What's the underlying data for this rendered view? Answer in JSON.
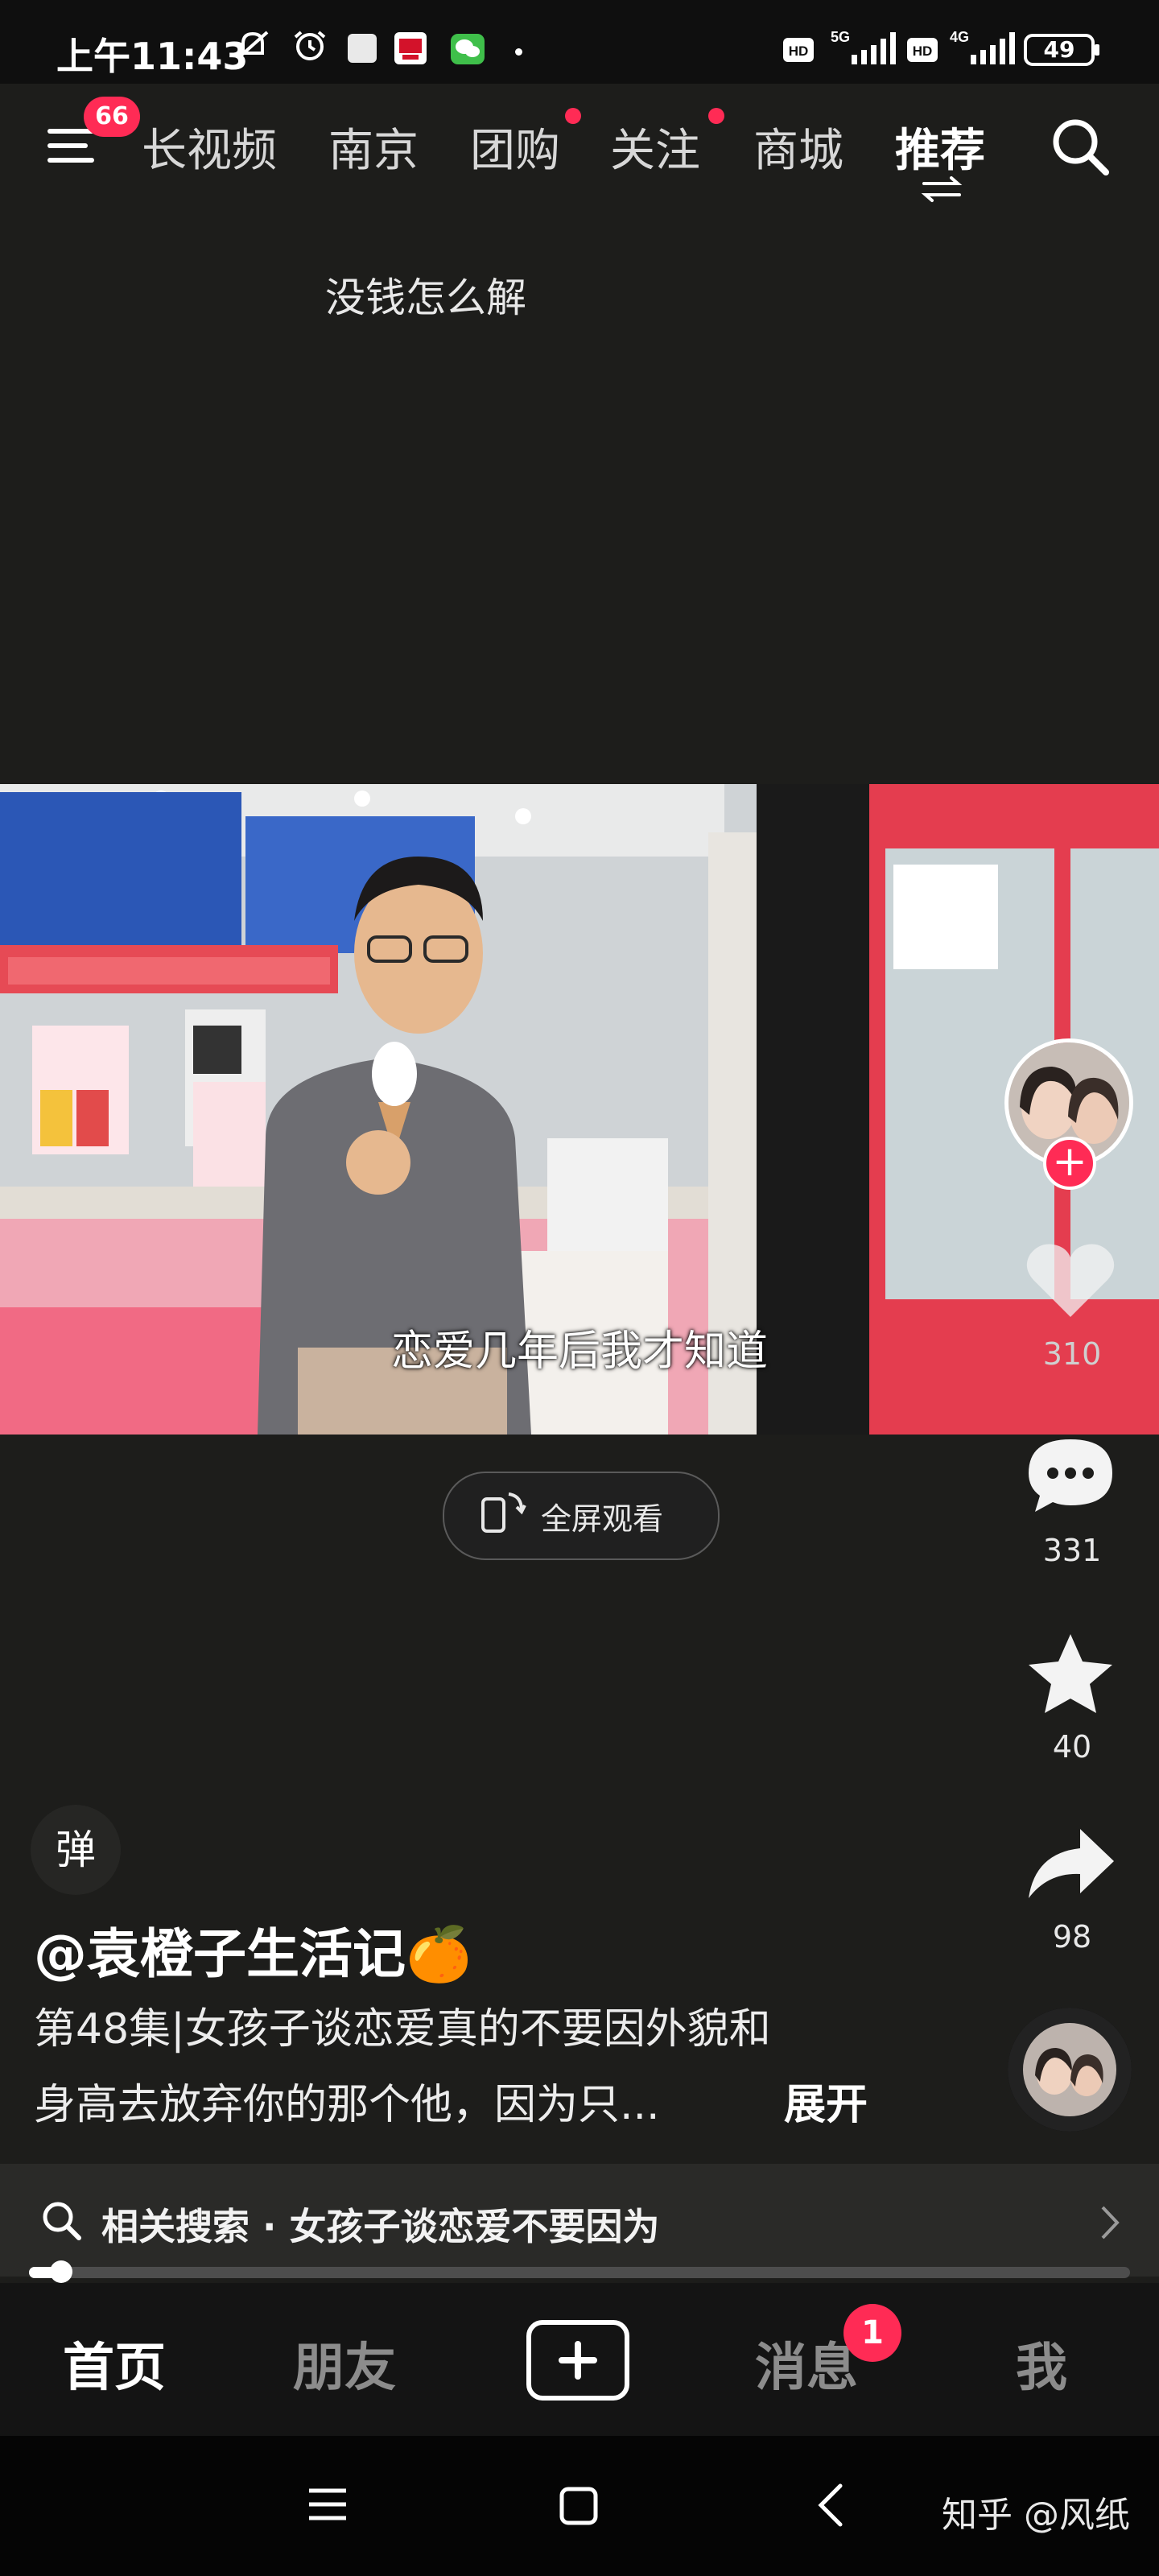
{
  "status_bar": {
    "time": "上午11:43",
    "network_1": "5G",
    "network_2": "4G",
    "hd_label": "HD",
    "battery": "49"
  },
  "top_nav": {
    "menu_badge": "66",
    "tabs": [
      {
        "label": "长视频",
        "active": false,
        "dot": false
      },
      {
        "label": "南京",
        "active": false,
        "dot": false
      },
      {
        "label": "团购",
        "active": false,
        "dot": true
      },
      {
        "label": "关注",
        "active": false,
        "dot": true
      },
      {
        "label": "商城",
        "active": false,
        "dot": false
      },
      {
        "label": "推荐",
        "active": true,
        "dot": false
      }
    ]
  },
  "video": {
    "top_caption": "没钱怎么解",
    "subtitle": "恋爱几年后我才知道",
    "fullscreen_label": "全屏观看",
    "progress": 0.02
  },
  "actions": {
    "like_count": "310",
    "comment_count": "331",
    "favorite_count": "40",
    "share_count": "98"
  },
  "post": {
    "danmaku_label": "弹",
    "author": "@袁橙子生活记🍊",
    "description_line1": "第48集|女孩子谈恋爱真的不要因外貌和",
    "description_line2": "身高去放弃你的那个他，因为只...",
    "expand_label": "展开"
  },
  "related_search": {
    "label": "相关搜索 · 女孩子谈恋爱不要因为"
  },
  "bottom_nav": {
    "home": "首页",
    "friends": "朋友",
    "messages": "消息",
    "messages_badge": "1",
    "me": "我"
  },
  "watermark": "知乎 @风纸",
  "colors": {
    "background": "#1d1d1b",
    "accent_red": "#ff2b55"
  }
}
